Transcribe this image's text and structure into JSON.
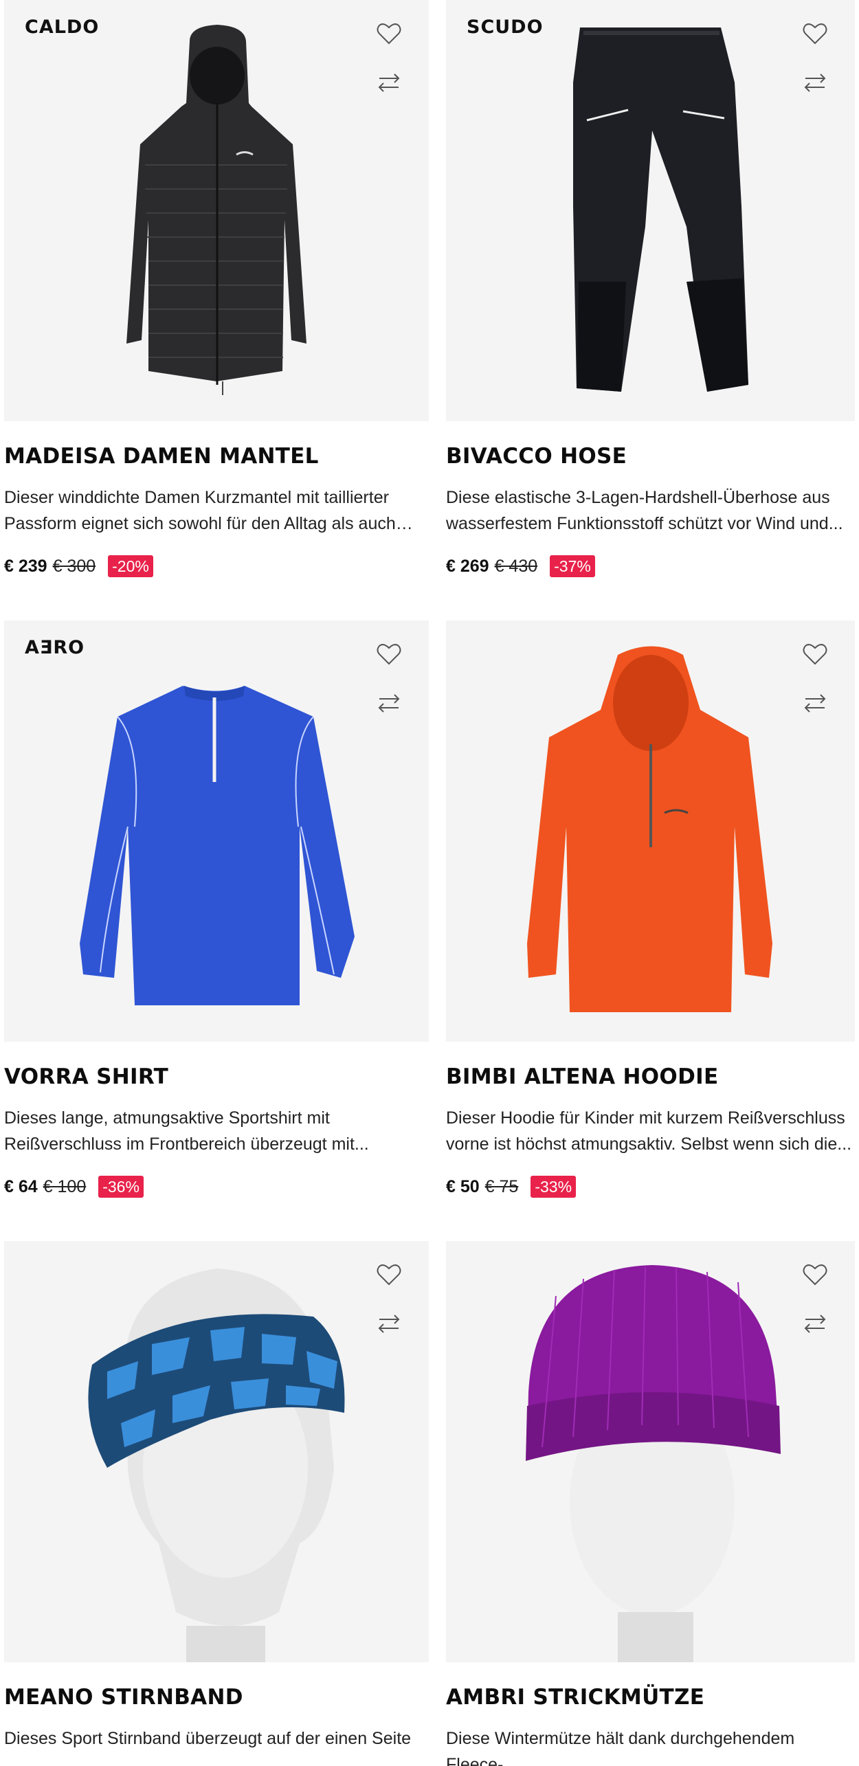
{
  "products": [
    {
      "brand": "CALDO",
      "title": "MADEISA DAMEN MANTEL",
      "description": "Dieser winddichte Damen Kurzmantel mit taillierter Passform eignet sich sowohl für den Alltag als auch für...",
      "price_now": "€ 239",
      "price_old": "€ 300",
      "discount": "-20%",
      "image": "black-coat",
      "wishlist_icon": "heart-icon",
      "compare_icon": "compare-arrows-icon"
    },
    {
      "brand": "SCUDO",
      "title": "BIVACCO HOSE",
      "description": "Diese elastische 3-Lagen-Hardshell-Überhose aus wasserfestem Funktionsstoff schützt vor Wind und...",
      "price_now": "€ 269",
      "price_old": "€ 430",
      "discount": "-37%",
      "image": "black-pants",
      "wishlist_icon": "heart-icon",
      "compare_icon": "compare-arrows-icon"
    },
    {
      "brand": "AƎRO",
      "title": "VORRA SHIRT",
      "description": "Dieses lange, atmungsaktive Sportshirt mit Reißverschluss im Frontbereich überzeugt mit...",
      "price_now": "€ 64",
      "price_old": "€ 100",
      "discount": "-36%",
      "image": "blue-shirt",
      "wishlist_icon": "heart-icon",
      "compare_icon": "compare-arrows-icon"
    },
    {
      "brand": "",
      "title": "BIMBI ALTENA HOODIE",
      "description": "Dieser Hoodie für Kinder mit kurzem Reißverschluss vorne ist höchst atmungsaktiv. Selbst wenn sich die...",
      "price_now": "€ 50",
      "price_old": "€ 75",
      "discount": "-33%",
      "image": "orange-hoodie",
      "wishlist_icon": "heart-icon",
      "compare_icon": "compare-arrows-icon"
    },
    {
      "brand": "",
      "title": "MEANO STIRNBAND",
      "description": "Dieses Sport Stirnband überzeugt auf der einen Seite",
      "price_now": "",
      "price_old": "",
      "discount": "",
      "image": "blue-headband",
      "wishlist_icon": "heart-icon",
      "compare_icon": "compare-arrows-icon"
    },
    {
      "brand": "",
      "title": "AMBRI STRICKMÜTZE",
      "description": "Diese Wintermütze hält dank durchgehendem Fleece-",
      "price_now": "",
      "price_old": "",
      "discount": "",
      "image": "purple-beanie",
      "wishlist_icon": "heart-icon",
      "compare_icon": "compare-arrows-icon"
    }
  ],
  "colors": {
    "image_bg": "#f4f4f4",
    "badge": "#e8224a",
    "coat": "#2b2b2e",
    "pants": "#1e1f24",
    "shirt": "#2f55d4",
    "hoodie": "#f0531f",
    "headband_dark": "#1d4b78",
    "headband_light": "#3a8fdb",
    "beanie": "#8a1a9e"
  }
}
